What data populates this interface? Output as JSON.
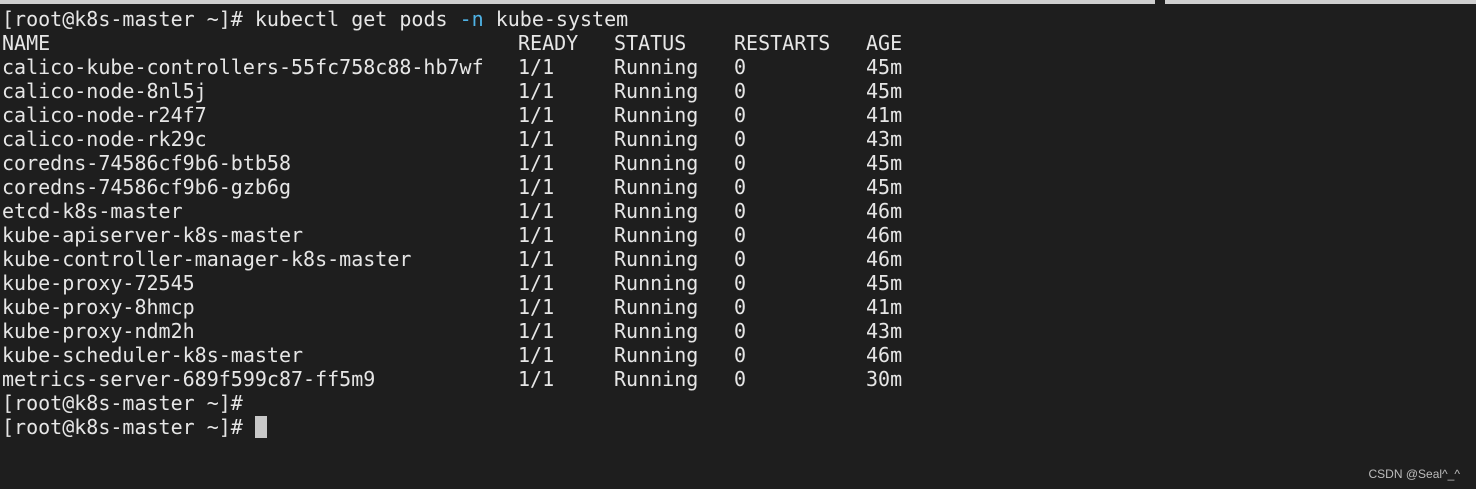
{
  "terminal": {
    "command": {
      "prompt": "[root@k8s-master ~]#",
      "cmd_before_flag": "kubectl get pods ",
      "flag": "-n",
      "cmd_after_flag": " kube-system"
    },
    "headers": {
      "name": "NAME",
      "ready": "READY",
      "status": "STATUS",
      "restarts": "RESTARTS",
      "age": "AGE"
    },
    "rows": [
      {
        "name": "calico-kube-controllers-55fc758c88-hb7wf",
        "ready": "1/1",
        "status": "Running",
        "restarts": "0",
        "age": "45m"
      },
      {
        "name": "calico-node-8nl5j",
        "ready": "1/1",
        "status": "Running",
        "restarts": "0",
        "age": "45m"
      },
      {
        "name": "calico-node-r24f7",
        "ready": "1/1",
        "status": "Running",
        "restarts": "0",
        "age": "41m"
      },
      {
        "name": "calico-node-rk29c",
        "ready": "1/1",
        "status": "Running",
        "restarts": "0",
        "age": "43m"
      },
      {
        "name": "coredns-74586cf9b6-btb58",
        "ready": "1/1",
        "status": "Running",
        "restarts": "0",
        "age": "45m"
      },
      {
        "name": "coredns-74586cf9b6-gzb6g",
        "ready": "1/1",
        "status": "Running",
        "restarts": "0",
        "age": "45m"
      },
      {
        "name": "etcd-k8s-master",
        "ready": "1/1",
        "status": "Running",
        "restarts": "0",
        "age": "46m"
      },
      {
        "name": "kube-apiserver-k8s-master",
        "ready": "1/1",
        "status": "Running",
        "restarts": "0",
        "age": "46m"
      },
      {
        "name": "kube-controller-manager-k8s-master",
        "ready": "1/1",
        "status": "Running",
        "restarts": "0",
        "age": "46m"
      },
      {
        "name": "kube-proxy-72545",
        "ready": "1/1",
        "status": "Running",
        "restarts": "0",
        "age": "45m"
      },
      {
        "name": "kube-proxy-8hmcp",
        "ready": "1/1",
        "status": "Running",
        "restarts": "0",
        "age": "41m"
      },
      {
        "name": "kube-proxy-ndm2h",
        "ready": "1/1",
        "status": "Running",
        "restarts": "0",
        "age": "43m"
      },
      {
        "name": "kube-scheduler-k8s-master",
        "ready": "1/1",
        "status": "Running",
        "restarts": "0",
        "age": "46m"
      },
      {
        "name": "metrics-server-689f599c87-ff5m9",
        "ready": "1/1",
        "status": "Running",
        "restarts": "0",
        "age": "30m"
      }
    ],
    "trailing_prompts": [
      "[root@k8s-master ~]#",
      "[root@k8s-master ~]#"
    ]
  },
  "watermark": "CSDN @Seal^_^",
  "colors": {
    "background": "#1e1e1e",
    "text": "#e6e6e6",
    "flag": "#4fb3e6",
    "cursor": "#c8c8c8"
  }
}
